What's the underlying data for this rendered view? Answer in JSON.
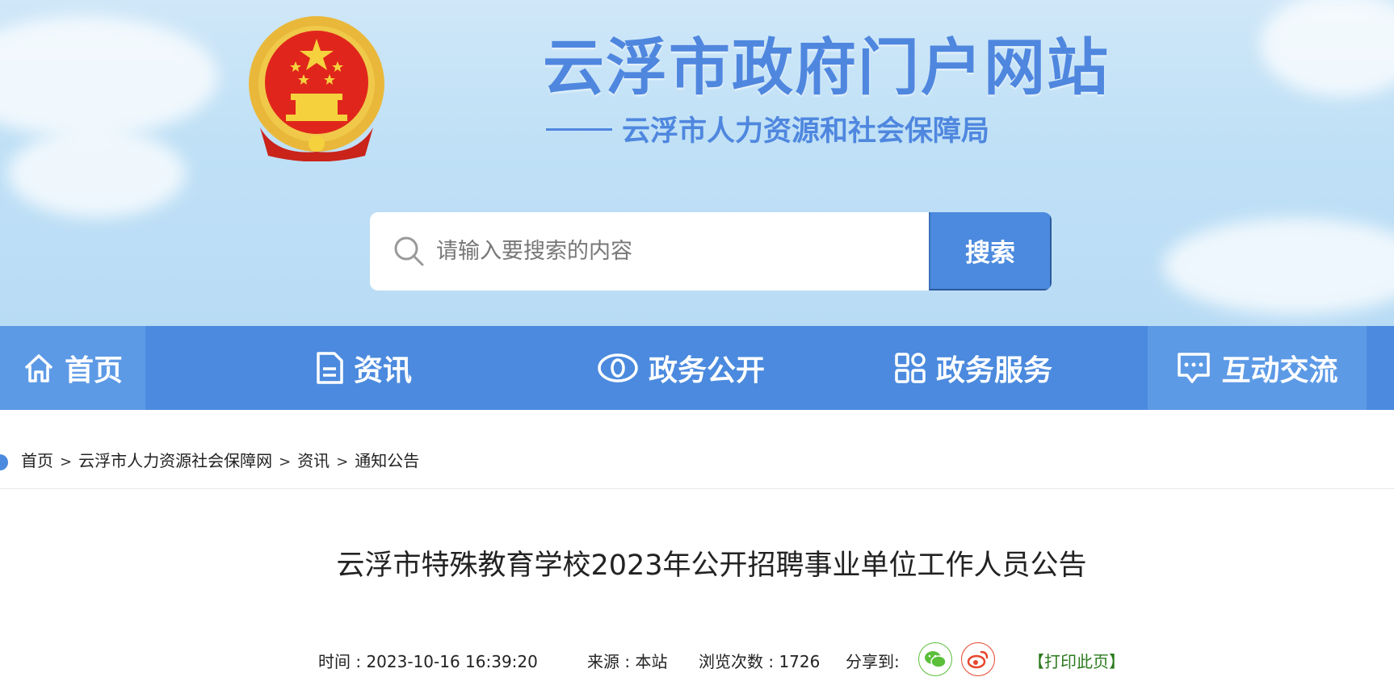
{
  "header": {
    "site_title": "云浮市政府门户网站",
    "site_subtitle": "云浮市人力资源和社会保障局",
    "search_placeholder": "请输入要搜索的内容",
    "search_button": "搜索"
  },
  "nav": {
    "items": [
      {
        "label": "首页",
        "icon": "home-icon"
      },
      {
        "label": "资讯",
        "icon": "document-icon"
      },
      {
        "label": "政务公开",
        "icon": "eye-icon"
      },
      {
        "label": "政务服务",
        "icon": "grid-icon"
      },
      {
        "label": "互动交流",
        "icon": "chat-icon"
      }
    ]
  },
  "breadcrumb": {
    "items": [
      "首页",
      "云浮市人力资源社会保障网",
      "资讯",
      "通知公告"
    ],
    "separator": ">"
  },
  "article": {
    "title": "云浮市特殊教育学校2023年公开招聘事业单位工作人员公告",
    "time": "时间 : 2023-10-16 16:39:20",
    "source": "来源 : 本站",
    "views": "浏览次数 : 1726",
    "share_label": "分享到:",
    "print_label": "【打印此页】"
  },
  "colors": {
    "primary": "#4b8ade",
    "title_blue": "#4f87df",
    "print_green": "#2b7a1d",
    "wechat_green": "#5bbf3a",
    "weibo_red": "#e6462e"
  }
}
